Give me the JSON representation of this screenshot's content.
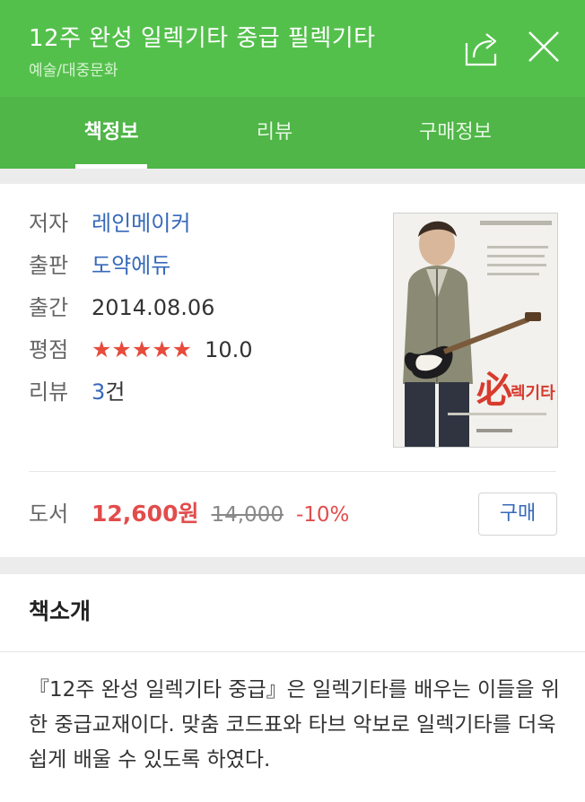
{
  "header": {
    "title": "12주 완성 일렉기타 중급 필렉기타",
    "category": "예술/대중문화",
    "share_icon": "share-icon",
    "close_icon": "close-icon"
  },
  "tabs": [
    {
      "label": "책정보",
      "active": true
    },
    {
      "label": "리뷰",
      "active": false
    },
    {
      "label": "구매정보",
      "active": false
    }
  ],
  "book": {
    "author_label": "저자",
    "author": "레인메이커",
    "publisher_label": "출판",
    "publisher": "도약에듀",
    "date_label": "출간",
    "date": "2014.08.06",
    "rating_label": "평점",
    "rating_stars": "★★★★★",
    "rating": "10.0",
    "review_label": "리뷰",
    "review_count": "3",
    "review_unit": "건"
  },
  "price": {
    "label": "도서",
    "sale_price": "12,600원",
    "original_price": "14,000",
    "discount": "-10%",
    "buy_label": "구매"
  },
  "intro": {
    "title": "책소개",
    "body": "『12주 완성 일렉기타 중급』은 일렉기타를 배우는 이들을 위한 중급교재이다. 맞춤 코드표와 타브 악보로 일렉기타를 더욱 쉽게 배울 수 있도록 하였다."
  },
  "colors": {
    "header_green": "#54c04c",
    "link_blue": "#3669b9",
    "price_red": "#e24c4c"
  }
}
